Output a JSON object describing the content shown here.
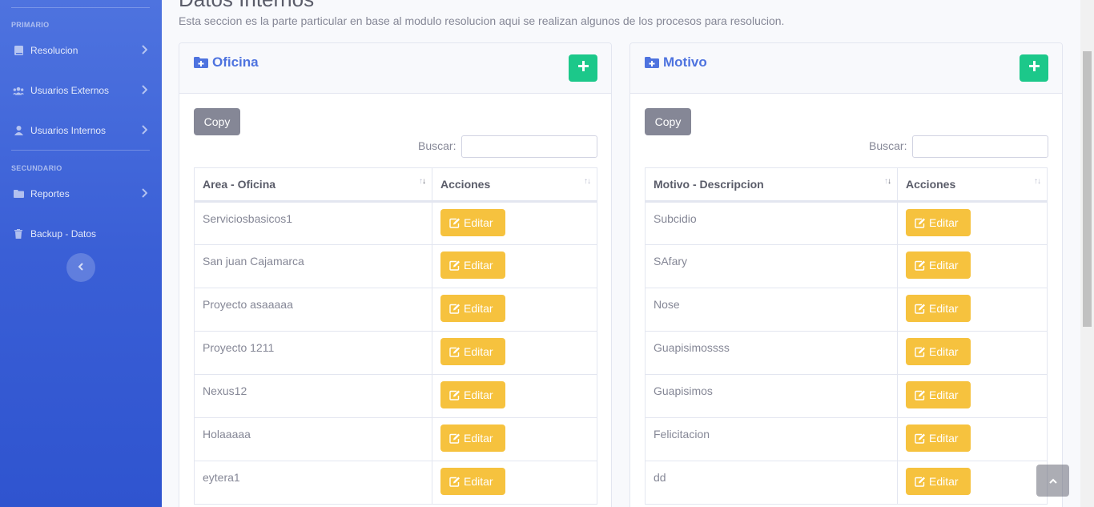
{
  "sidebar": {
    "headings": {
      "primary": "PRIMARIO",
      "secondary": "SECUNDARIO"
    },
    "items": [
      {
        "label": "Resolucion",
        "icon": "book-icon"
      },
      {
        "label": "Usuarios Externos",
        "icon": "users-icon"
      },
      {
        "label": "Usuarios Internos",
        "icon": "user-icon"
      },
      {
        "label": "Reportes",
        "icon": "folder-icon"
      },
      {
        "label": "Backup - Datos",
        "icon": "trash-icon"
      }
    ]
  },
  "page": {
    "title": "Datos Internos",
    "description": "Esta seccion es la parte particular en base al modulo resolucion aqui se realizan algunos de los procesos para resolucion."
  },
  "oficina": {
    "title": "Oficina",
    "copy_label": "Copy",
    "search_label": "Buscar:",
    "columns": [
      "Area - Oficina",
      "Acciones"
    ],
    "edit_label": "Editar",
    "rows": [
      "Serviciosbasicos1",
      "San juan Cajamarca",
      "Proyecto asaaaaa",
      "Proyecto 1211",
      "Nexus12",
      "Holaaaaa",
      "eytera1"
    ]
  },
  "motivo": {
    "title": "Motivo",
    "copy_label": "Copy",
    "search_label": "Buscar:",
    "columns": [
      "Motivo - Descripcion",
      "Acciones"
    ],
    "edit_label": "Editar",
    "rows": [
      "Subcidio",
      "SAfary",
      "Nose",
      "Guapisimossss",
      "Guapisimos",
      "Felicitacion",
      "dd"
    ]
  },
  "colors": {
    "primary": "#4e73df",
    "success": "#1cc88a",
    "warning": "#f6c23e",
    "secondary": "#858796"
  }
}
